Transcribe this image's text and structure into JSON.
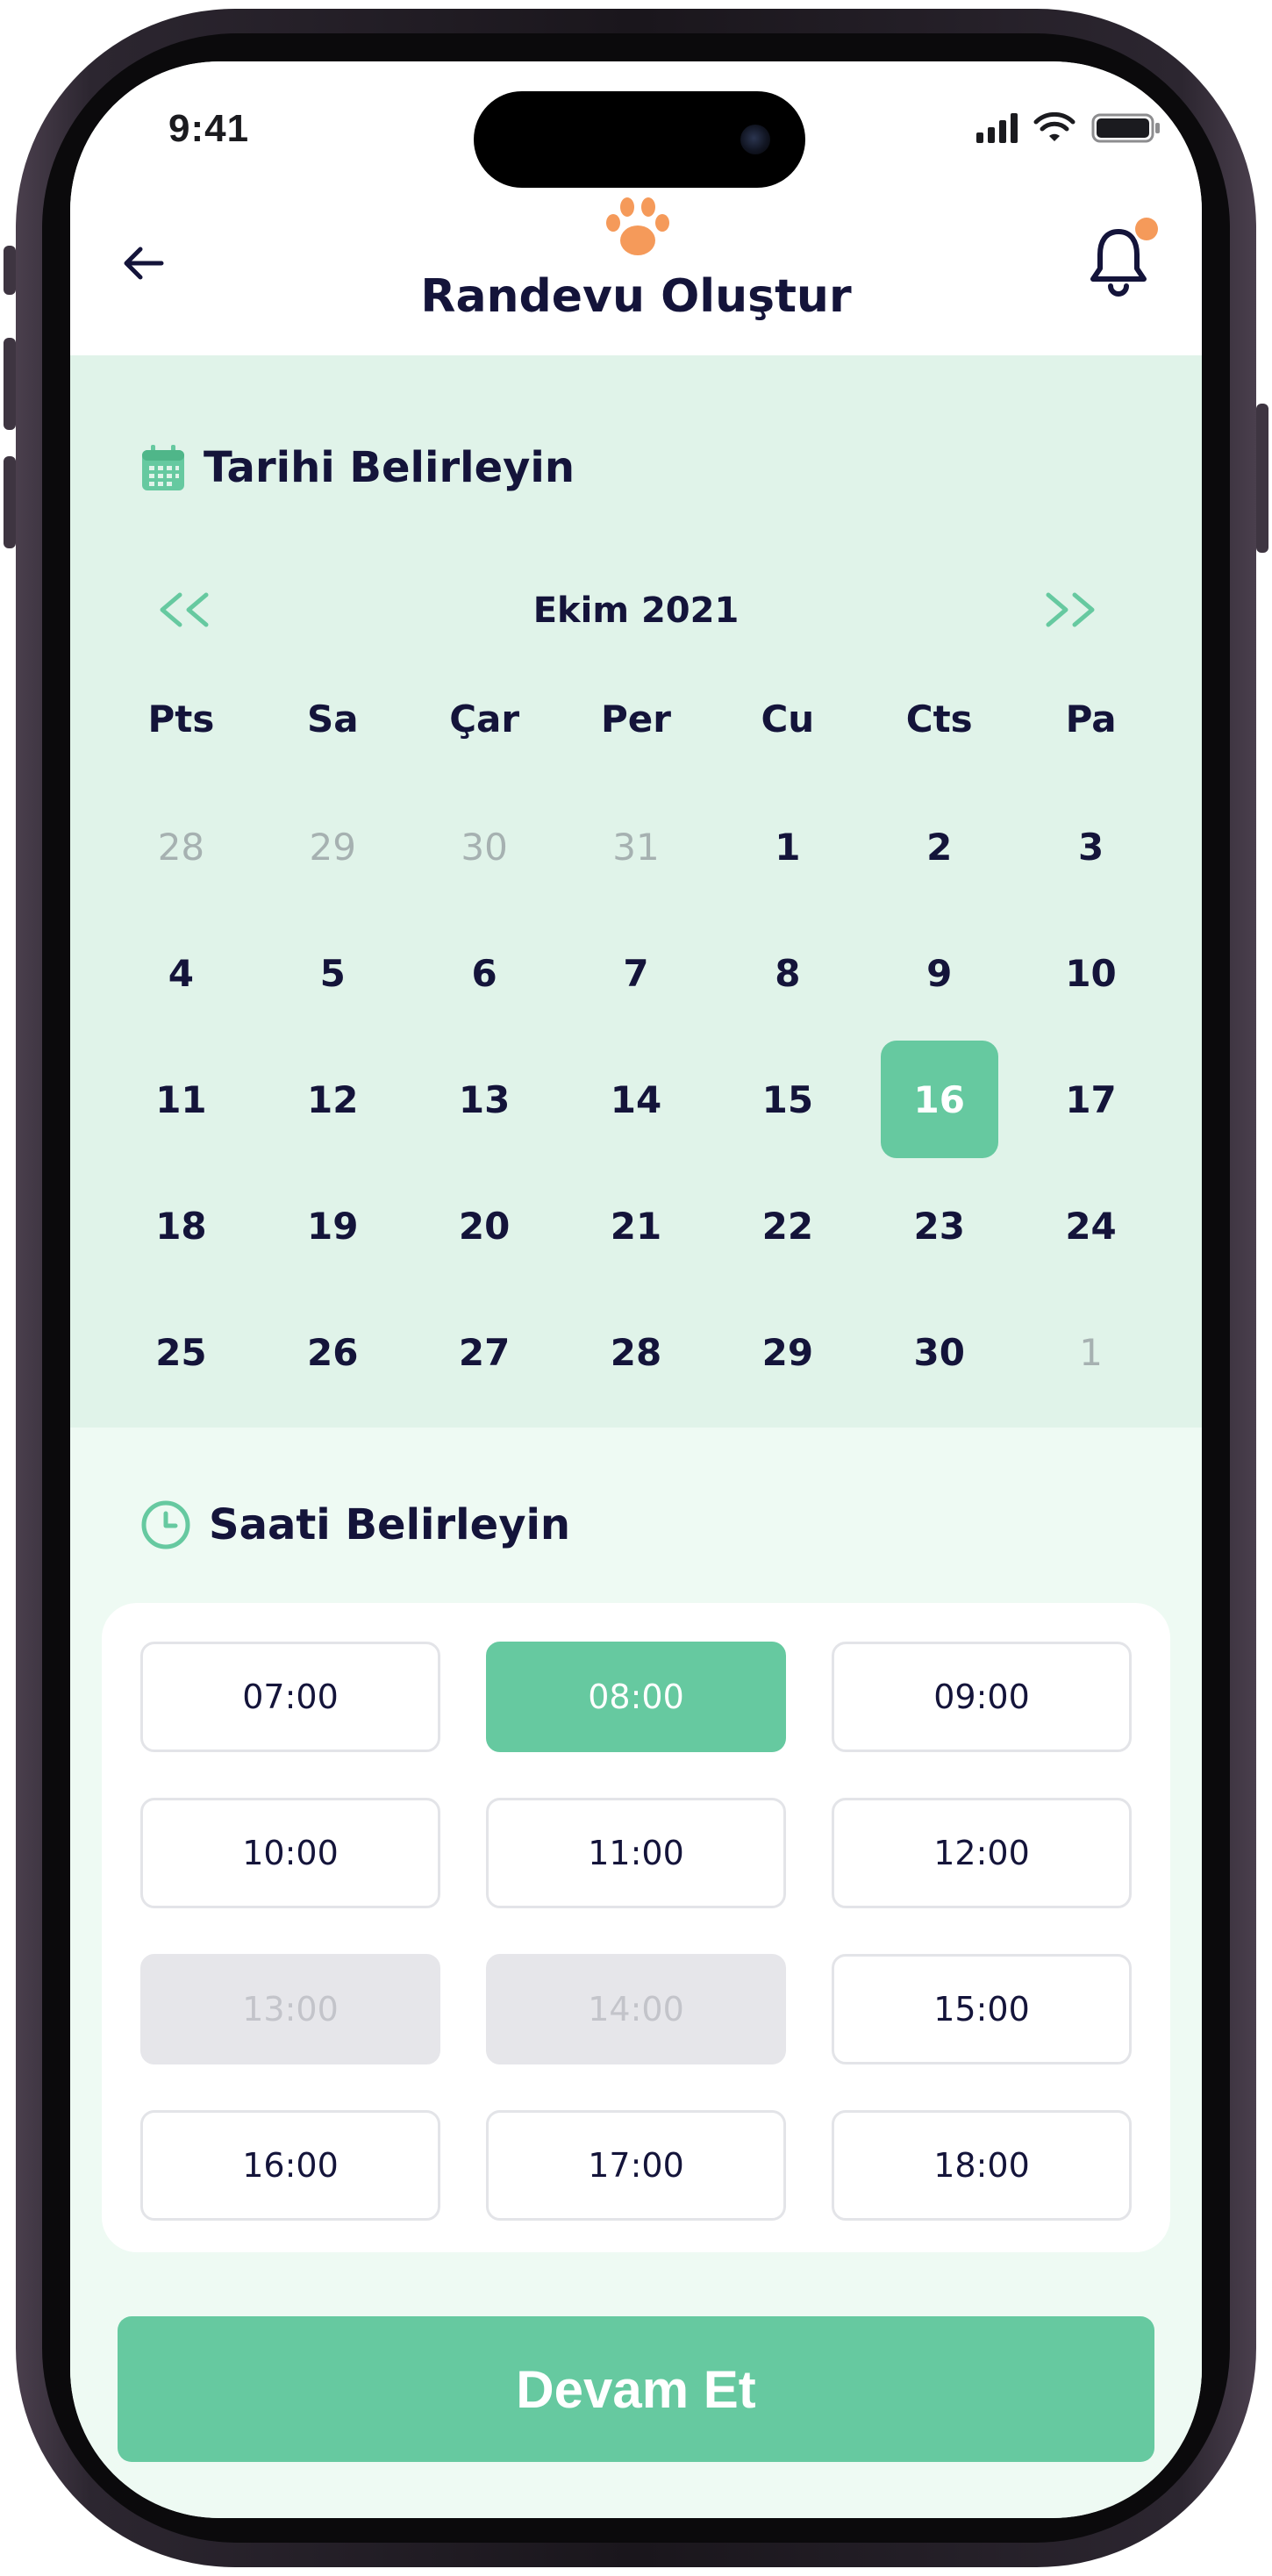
{
  "status_bar": {
    "time": "9:41",
    "icons": [
      "cellular-signal-icon",
      "wifi-icon",
      "battery-icon"
    ]
  },
  "header": {
    "title": "Randevu Oluştur",
    "back_icon": "arrow-left-icon",
    "logo_icon": "paw-icon",
    "notification_icon": "bell-icon",
    "notification_badge": true
  },
  "date_section": {
    "title": "Tarihi Belirleyin",
    "icon": "calendar-icon",
    "month": "Ekim 2021",
    "prev_label": "<<",
    "next_label": ">>",
    "weekdays": [
      "Pts",
      "Sa",
      "Çar",
      "Per",
      "Cu",
      "Cts",
      "Pa"
    ],
    "days": [
      {
        "label": "28",
        "muted": true
      },
      {
        "label": "29",
        "muted": true
      },
      {
        "label": "30",
        "muted": true
      },
      {
        "label": "31",
        "muted": true
      },
      {
        "label": "1"
      },
      {
        "label": "2"
      },
      {
        "label": "3"
      },
      {
        "label": "4"
      },
      {
        "label": "5"
      },
      {
        "label": "6"
      },
      {
        "label": "7"
      },
      {
        "label": "8"
      },
      {
        "label": "9"
      },
      {
        "label": "10"
      },
      {
        "label": "11"
      },
      {
        "label": "12"
      },
      {
        "label": "13"
      },
      {
        "label": "14"
      },
      {
        "label": "15"
      },
      {
        "label": "16",
        "selected": true
      },
      {
        "label": "17"
      },
      {
        "label": "18"
      },
      {
        "label": "19"
      },
      {
        "label": "20"
      },
      {
        "label": "21"
      },
      {
        "label": "22"
      },
      {
        "label": "23"
      },
      {
        "label": "24"
      },
      {
        "label": "25"
      },
      {
        "label": "26"
      },
      {
        "label": "27"
      },
      {
        "label": "28"
      },
      {
        "label": "29"
      },
      {
        "label": "30"
      },
      {
        "label": "1",
        "muted": true
      }
    ]
  },
  "time_section": {
    "title": "Saati Belirleyin",
    "icon": "clock-icon",
    "slots": [
      {
        "label": "07:00"
      },
      {
        "label": "08:00",
        "selected": true
      },
      {
        "label": "09:00"
      },
      {
        "label": "10:00"
      },
      {
        "label": "11:00"
      },
      {
        "label": "12:00"
      },
      {
        "label": "13:00",
        "disabled": true
      },
      {
        "label": "14:00",
        "disabled": true
      },
      {
        "label": "15:00"
      },
      {
        "label": "16:00"
      },
      {
        "label": "17:00"
      },
      {
        "label": "18:00"
      }
    ]
  },
  "cta": {
    "label": "Devam Et"
  },
  "colors": {
    "accent": "#66c9a0",
    "orange": "#f59a5a",
    "text": "#14143a",
    "calendar_bg": "#e0f3e9",
    "page_bg": "#eefaf3",
    "disabled": "#e6e6ea"
  }
}
